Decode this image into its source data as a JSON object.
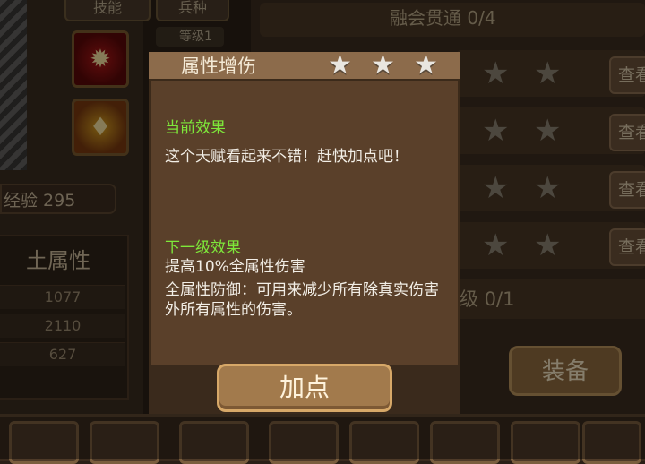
{
  "background": {
    "tabs": [
      "技能",
      "兵种"
    ],
    "level_badge": "等级1",
    "experience": "经验 295",
    "attribute": {
      "title": "土属性",
      "values": [
        "1077",
        "2110",
        "627"
      ]
    },
    "mastery": "融会贯通 0/4",
    "view_label": "查看",
    "level_strip": "级 0/1",
    "equip_button": "装备"
  },
  "popup": {
    "title": "属性增伤",
    "stars": 3,
    "current_effect_heading": "当前效果",
    "current_effect_text": "这个天赋看起来不错！赶快加点吧！",
    "next_effect_heading": "下一级效果",
    "next_effect_line1": "提高10%全属性伤害",
    "next_effect_line2": "全属性防御：可用来减少所有除真实伤害外所有属性的伤害。",
    "add_point_button": "加点"
  },
  "colors": {
    "effect_heading": "#7ee83a",
    "popup_bg": "#5a402a",
    "button": "#a27a4c"
  }
}
